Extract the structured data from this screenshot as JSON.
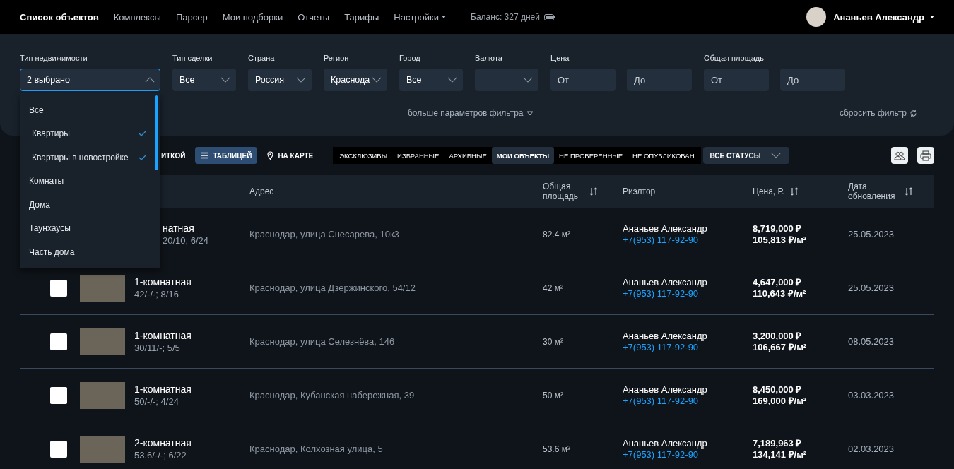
{
  "nav": {
    "items": [
      {
        "label": "Список объектов",
        "selected": true,
        "caret": false
      },
      {
        "label": "Комплексы",
        "selected": false,
        "caret": false
      },
      {
        "label": "Парсер",
        "selected": false,
        "caret": false
      },
      {
        "label": "Мои подборки",
        "selected": false,
        "caret": false
      },
      {
        "label": "Отчеты",
        "selected": false,
        "caret": false
      },
      {
        "label": "Тарифы",
        "selected": false,
        "caret": false
      },
      {
        "label": "Настройки",
        "selected": false,
        "caret": true
      }
    ],
    "balance": "Баланс: 327 дней",
    "user": "Ананьев Александр"
  },
  "filters": [
    {
      "kind": "select",
      "label": "Тип недвижимости",
      "value": "2 выбрано",
      "expanded": true
    },
    {
      "kind": "select",
      "label": "Тип сделки",
      "value": "Все",
      "expanded": false
    },
    {
      "kind": "select",
      "label": "Страна",
      "value": "Россия",
      "expanded": false
    },
    {
      "kind": "select",
      "label": "Регион",
      "value": "Краснода",
      "expanded": false
    },
    {
      "kind": "select",
      "label": "Город",
      "value": "Все",
      "expanded": false
    },
    {
      "kind": "select",
      "label": "Валюта",
      "expanded": false
    },
    {
      "kind": "range",
      "label": "Цена",
      "fields": [
        {
          "placeholder": "От"
        },
        {
          "placeholder": "До"
        }
      ]
    },
    {
      "kind": "range",
      "label": "Общая площадь",
      "fields": [
        {
          "placeholder": "От"
        },
        {
          "placeholder": "До"
        }
      ]
    }
  ],
  "more_filters": "больше параметров фильтра",
  "reset_filter": "сбросить фильтр",
  "dropdown": [
    {
      "label": "Все",
      "checked": false
    },
    {
      "label": "Квартиры",
      "checked": true
    },
    {
      "label": "Квартиры в новостройке",
      "checked": true
    },
    {
      "label": "Комнаты",
      "checked": false
    },
    {
      "label": "Дома",
      "checked": false
    },
    {
      "label": "Таунхаусы",
      "checked": false
    },
    {
      "label": "Часть дома",
      "checked": false
    }
  ],
  "views": [
    {
      "label": "ИТКОЙ",
      "selected": false
    },
    {
      "label": "ТАБЛИЦЕЙ",
      "selected": true
    },
    {
      "label": "НА КАРТЕ",
      "selected": false
    }
  ],
  "status_tabs": [
    {
      "label": "ЭКСКЛЮЗИВЫ",
      "selected": false
    },
    {
      "label": "ИЗБРАННЫЕ",
      "selected": false
    },
    {
      "label": "АРХИВНЫЕ",
      "selected": false
    },
    {
      "label": "МОИ ОБЪЕКТЫ",
      "selected": true
    },
    {
      "label": "НЕ ПРОВЕРЕННЫЕ",
      "selected": false
    },
    {
      "label": "НЕ ОПУБЛИКОВАН",
      "selected": false
    }
  ],
  "status_select": "ВСЕ СТАТУСЫ",
  "table": {
    "columns": [
      {
        "label": "Адрес",
        "sortable": false
      },
      {
        "label": "Общая площадь",
        "sortable": true
      },
      {
        "label": "Риэлтор",
        "sortable": false
      },
      {
        "label": "Цена, Р.",
        "sortable": true
      },
      {
        "label": "Дата обновления",
        "sortable": true
      }
    ],
    "rows": [
      {
        "title": "натная",
        "details": "20/10; 6/24",
        "address": "Краснодар, улица Снесарева, 10к3",
        "area": "82.4 м²",
        "realtor": "Ананьев Александр",
        "phone": "+7(953) 117-92-90",
        "price": "8,719,000 ₽",
        "price_m2": "105,813 ₽/м²",
        "date": "25.05.2023"
      },
      {
        "checked": false,
        "title": "1-комнатная",
        "details": "42/-/-; 8/16",
        "address": "Краснодар, улица Дзержинского, 54/12",
        "area": "42 м²",
        "realtor": "Ананьев Александр",
        "phone": "+7(953) 117-92-90",
        "price": "4,647,000 ₽",
        "price_m2": "110,643 ₽/м²",
        "date": "25.05.2023"
      },
      {
        "checked": false,
        "title": "1-комнатная",
        "details": "30/11/-; 5/5",
        "address": "Краснодар, улица Селезнёва, 146",
        "area": "30 м²",
        "realtor": "Ананьев Александр",
        "phone": "+7(953) 117-92-90",
        "price": "3,200,000 ₽",
        "price_m2": "106,667 ₽/м²",
        "date": "08.05.2023"
      },
      {
        "checked": false,
        "title": "1-комнатная",
        "details": "50/-/-; 4/24",
        "address": "Краснодар, Кубанская набережная, 39",
        "area": "50 м²",
        "realtor": "Ананьев Александр",
        "phone": "+7(953) 117-92-90",
        "price": "8,450,000 ₽",
        "price_m2": "169,000 ₽/м²",
        "date": "03.03.2023"
      },
      {
        "checked": false,
        "title": "2-комнатная",
        "details": "53.6/-/-; 6/22",
        "address": "Краснодар, Колхозная улица, 5",
        "area": "53.6 м²",
        "realtor": "Ананьев Александр",
        "phone": "+7(953) 117-92-90",
        "price": "7,189,963 ₽",
        "price_m2": "134,141 ₽/м²",
        "date": "02.03.2023"
      }
    ]
  }
}
